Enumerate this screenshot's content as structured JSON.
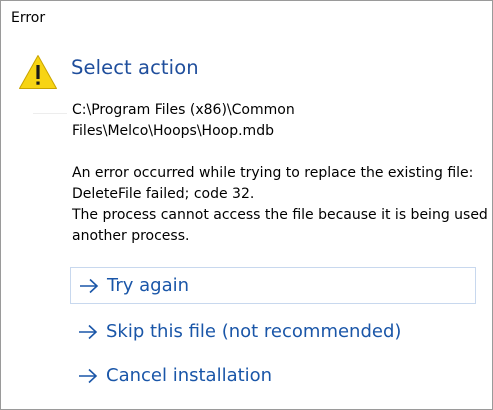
{
  "window": {
    "title": "Error"
  },
  "dialog": {
    "icon": "warning-icon",
    "heading": "Select action",
    "path_lines": [
      "C:\\Program Files (x86)\\Common",
      "Files\\Melco\\Hoops\\Hoop.mdb"
    ],
    "message_lines": [
      "An error occurred while trying to replace the existing file:",
      "DeleteFile failed; code 32.",
      "The process cannot access the file because it is being used by",
      "another process."
    ]
  },
  "actions": [
    {
      "label": "Try again",
      "icon": "arrow-right-icon"
    },
    {
      "label": "Skip this file (not recommended)",
      "icon": "arrow-right-icon"
    },
    {
      "label": "Cancel installation",
      "icon": "arrow-right-icon"
    }
  ],
  "colors": {
    "heading": "#1f4e9c",
    "action_link": "#1a56a8",
    "warning_fill": "#f7d414",
    "focus_border": "#c8d8ee"
  }
}
